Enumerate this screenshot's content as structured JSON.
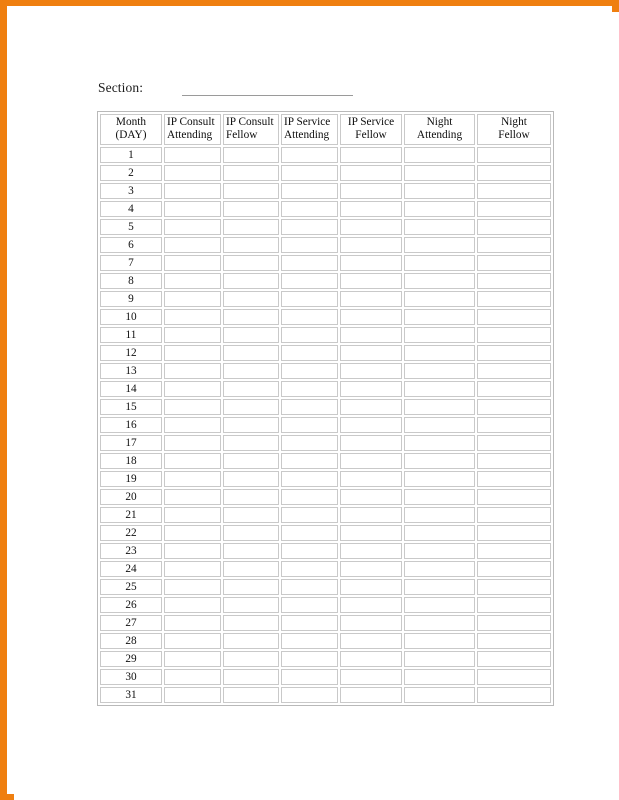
{
  "page": {
    "frame_color": "#ef7f10",
    "background_color": "#ffffff"
  },
  "section": {
    "label": "Section:",
    "value": "",
    "placeholder": ""
  },
  "table": {
    "headers": [
      {
        "key": "month_day",
        "line1": "Month",
        "line2": "(DAY)",
        "align": "center",
        "bold": true
      },
      {
        "key": "ip_consult_attending",
        "line1": "IP Consult",
        "line2": "Attending",
        "align": "left",
        "bold": false
      },
      {
        "key": "ip_consult_fellow",
        "line1": "IP Consult",
        "line2": "Fellow",
        "align": "left",
        "bold": false
      },
      {
        "key": "ip_service_attending",
        "line1": "IP Service",
        "line2": "Attending",
        "align": "left",
        "bold": false
      },
      {
        "key": "ip_service_fellow",
        "line1": "IP Service",
        "line2": "Fellow",
        "align": "center",
        "bold": false
      },
      {
        "key": "night_attending",
        "line1": "Night",
        "line2": "Attending",
        "align": "center",
        "bold": false
      },
      {
        "key": "night_fellow",
        "line1": "Night",
        "line2": "Fellow",
        "align": "center",
        "bold": false
      }
    ],
    "rows": [
      {
        "day": "1",
        "ip_consult_attending": "",
        "ip_consult_fellow": "",
        "ip_service_attending": "",
        "ip_service_fellow": "",
        "night_attending": "",
        "night_fellow": ""
      },
      {
        "day": "2",
        "ip_consult_attending": "",
        "ip_consult_fellow": "",
        "ip_service_attending": "",
        "ip_service_fellow": "",
        "night_attending": "",
        "night_fellow": ""
      },
      {
        "day": "3",
        "ip_consult_attending": "",
        "ip_consult_fellow": "",
        "ip_service_attending": "",
        "ip_service_fellow": "",
        "night_attending": "",
        "night_fellow": ""
      },
      {
        "day": "4",
        "ip_consult_attending": "",
        "ip_consult_fellow": "",
        "ip_service_attending": "",
        "ip_service_fellow": "",
        "night_attending": "",
        "night_fellow": ""
      },
      {
        "day": "5",
        "ip_consult_attending": "",
        "ip_consult_fellow": "",
        "ip_service_attending": "",
        "ip_service_fellow": "",
        "night_attending": "",
        "night_fellow": ""
      },
      {
        "day": "6",
        "ip_consult_attending": "",
        "ip_consult_fellow": "",
        "ip_service_attending": "",
        "ip_service_fellow": "",
        "night_attending": "",
        "night_fellow": ""
      },
      {
        "day": "7",
        "ip_consult_attending": "",
        "ip_consult_fellow": "",
        "ip_service_attending": "",
        "ip_service_fellow": "",
        "night_attending": "",
        "night_fellow": ""
      },
      {
        "day": "8",
        "ip_consult_attending": "",
        "ip_consult_fellow": "",
        "ip_service_attending": "",
        "ip_service_fellow": "",
        "night_attending": "",
        "night_fellow": ""
      },
      {
        "day": "9",
        "ip_consult_attending": "",
        "ip_consult_fellow": "",
        "ip_service_attending": "",
        "ip_service_fellow": "",
        "night_attending": "",
        "night_fellow": ""
      },
      {
        "day": "10",
        "ip_consult_attending": "",
        "ip_consult_fellow": "",
        "ip_service_attending": "",
        "ip_service_fellow": "",
        "night_attending": "",
        "night_fellow": ""
      },
      {
        "day": "11",
        "ip_consult_attending": "",
        "ip_consult_fellow": "",
        "ip_service_attending": "",
        "ip_service_fellow": "",
        "night_attending": "",
        "night_fellow": ""
      },
      {
        "day": "12",
        "ip_consult_attending": "",
        "ip_consult_fellow": "",
        "ip_service_attending": "",
        "ip_service_fellow": "",
        "night_attending": "",
        "night_fellow": ""
      },
      {
        "day": "13",
        "ip_consult_attending": "",
        "ip_consult_fellow": "",
        "ip_service_attending": "",
        "ip_service_fellow": "",
        "night_attending": "",
        "night_fellow": ""
      },
      {
        "day": "14",
        "ip_consult_attending": "",
        "ip_consult_fellow": "",
        "ip_service_attending": "",
        "ip_service_fellow": "",
        "night_attending": "",
        "night_fellow": ""
      },
      {
        "day": "15",
        "ip_consult_attending": "",
        "ip_consult_fellow": "",
        "ip_service_attending": "",
        "ip_service_fellow": "",
        "night_attending": "",
        "night_fellow": ""
      },
      {
        "day": "16",
        "ip_consult_attending": "",
        "ip_consult_fellow": "",
        "ip_service_attending": "",
        "ip_service_fellow": "",
        "night_attending": "",
        "night_fellow": ""
      },
      {
        "day": "17",
        "ip_consult_attending": "",
        "ip_consult_fellow": "",
        "ip_service_attending": "",
        "ip_service_fellow": "",
        "night_attending": "",
        "night_fellow": ""
      },
      {
        "day": "18",
        "ip_consult_attending": "",
        "ip_consult_fellow": "",
        "ip_service_attending": "",
        "ip_service_fellow": "",
        "night_attending": "",
        "night_fellow": ""
      },
      {
        "day": "19",
        "ip_consult_attending": "",
        "ip_consult_fellow": "",
        "ip_service_attending": "",
        "ip_service_fellow": "",
        "night_attending": "",
        "night_fellow": ""
      },
      {
        "day": "20",
        "ip_consult_attending": "",
        "ip_consult_fellow": "",
        "ip_service_attending": "",
        "ip_service_fellow": "",
        "night_attending": "",
        "night_fellow": ""
      },
      {
        "day": "21",
        "ip_consult_attending": "",
        "ip_consult_fellow": "",
        "ip_service_attending": "",
        "ip_service_fellow": "",
        "night_attending": "",
        "night_fellow": ""
      },
      {
        "day": "22",
        "ip_consult_attending": "",
        "ip_consult_fellow": "",
        "ip_service_attending": "",
        "ip_service_fellow": "",
        "night_attending": "",
        "night_fellow": ""
      },
      {
        "day": "23",
        "ip_consult_attending": "",
        "ip_consult_fellow": "",
        "ip_service_attending": "",
        "ip_service_fellow": "",
        "night_attending": "",
        "night_fellow": ""
      },
      {
        "day": "24",
        "ip_consult_attending": "",
        "ip_consult_fellow": "",
        "ip_service_attending": "",
        "ip_service_fellow": "",
        "night_attending": "",
        "night_fellow": ""
      },
      {
        "day": "25",
        "ip_consult_attending": "",
        "ip_consult_fellow": "",
        "ip_service_attending": "",
        "ip_service_fellow": "",
        "night_attending": "",
        "night_fellow": ""
      },
      {
        "day": "26",
        "ip_consult_attending": "",
        "ip_consult_fellow": "",
        "ip_service_attending": "",
        "ip_service_fellow": "",
        "night_attending": "",
        "night_fellow": ""
      },
      {
        "day": "27",
        "ip_consult_attending": "",
        "ip_consult_fellow": "",
        "ip_service_attending": "",
        "ip_service_fellow": "",
        "night_attending": "",
        "night_fellow": ""
      },
      {
        "day": "28",
        "ip_consult_attending": "",
        "ip_consult_fellow": "",
        "ip_service_attending": "",
        "ip_service_fellow": "",
        "night_attending": "",
        "night_fellow": ""
      },
      {
        "day": "29",
        "ip_consult_attending": "",
        "ip_consult_fellow": "",
        "ip_service_attending": "",
        "ip_service_fellow": "",
        "night_attending": "",
        "night_fellow": ""
      },
      {
        "day": "30",
        "ip_consult_attending": "",
        "ip_consult_fellow": "",
        "ip_service_attending": "",
        "ip_service_fellow": "",
        "night_attending": "",
        "night_fellow": ""
      },
      {
        "day": "31",
        "ip_consult_attending": "",
        "ip_consult_fellow": "",
        "ip_service_attending": "",
        "ip_service_fellow": "",
        "night_attending": "",
        "night_fellow": ""
      }
    ]
  }
}
